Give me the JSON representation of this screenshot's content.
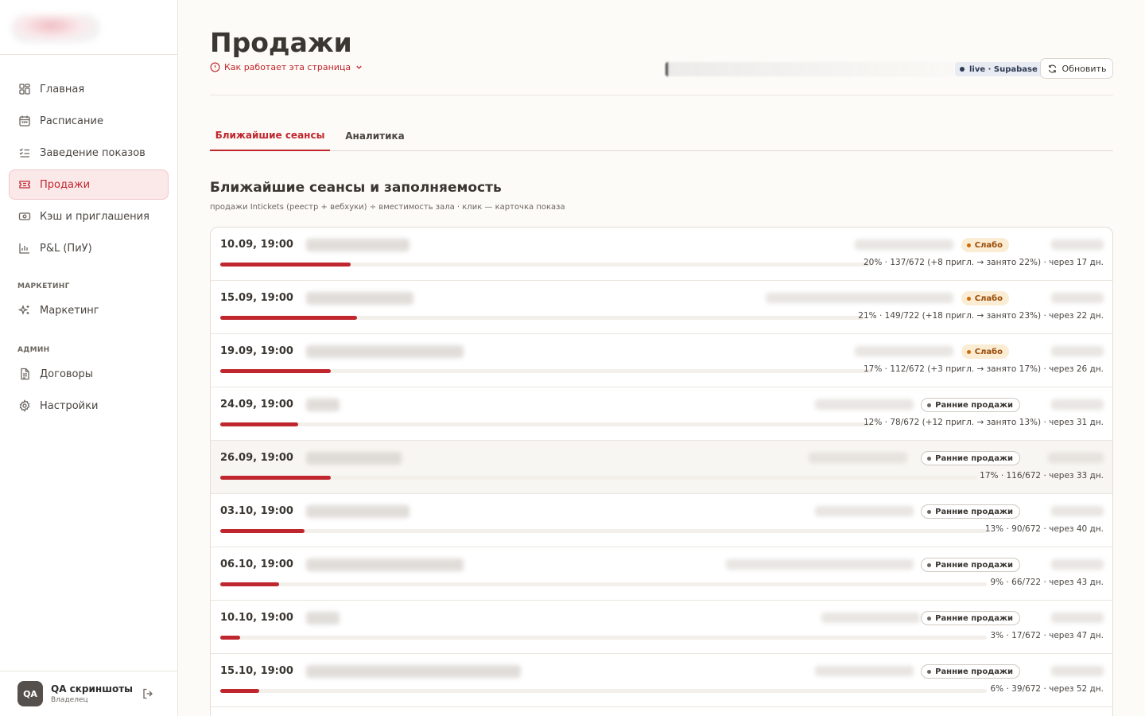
{
  "sidebar": {
    "items": [
      {
        "label": "Главная",
        "icon": "dashboard-icon"
      },
      {
        "label": "Расписание",
        "icon": "calendar-icon"
      },
      {
        "label": "Заведение показов",
        "icon": "list-check-icon"
      },
      {
        "label": "Продажи",
        "icon": "ticket-icon",
        "active": true
      },
      {
        "label": "Кэш и приглашения",
        "icon": "cash-icon"
      },
      {
        "label": "P&L (ПиУ)",
        "icon": "chart-bar-icon"
      }
    ],
    "marketing_section": "МАРКЕТИНГ",
    "marketing_items": [
      {
        "label": "Маркетинг",
        "icon": "sparkles-icon"
      }
    ],
    "admin_section": "АДМИН",
    "admin_items": [
      {
        "label": "Договоры",
        "icon": "document-icon"
      },
      {
        "label": "Настройки",
        "icon": "gear-icon"
      }
    ],
    "user": {
      "initials": "QA",
      "name": "QA скриншоты",
      "role": "Владелец"
    }
  },
  "header": {
    "title": "Продажи",
    "how_link": "Как работает эта страница",
    "live_badge": "live · Supabase",
    "refresh_label": "Обновить"
  },
  "tabs": [
    {
      "label": "Ближайшие сеансы",
      "active": true
    },
    {
      "label": "Аналитика",
      "active": false
    }
  ],
  "section": {
    "title": "Ближайшие сеансы и заполняемость",
    "subtitle": "продажи Intickets (реестр + вебхуки) ÷ вместимость зала · клик — карточка показа"
  },
  "colors": {
    "accent": "#c0262d",
    "weak_badge": "#fbecd4",
    "weak_text": "#9a4b06"
  },
  "sessions": [
    {
      "date": "10.09, 19:00",
      "badge": "Слабо",
      "badge_type": "weak",
      "fill": 0.2,
      "stats": "20% · 137/672 (+8 пригл. → занято 22%) · через 17 дн."
    },
    {
      "date": "15.09, 19:00",
      "badge": "Слабо",
      "badge_type": "weak",
      "fill": 0.21,
      "stats": "21% · 149/722 (+18 пригл. → занято 23%) · через 22 дн."
    },
    {
      "date": "19.09, 19:00",
      "badge": "Слабо",
      "badge_type": "weak",
      "fill": 0.17,
      "stats": "17% · 112/672 (+3 пригл. → занято 17%) · через 26 дн."
    },
    {
      "date": "24.09, 19:00",
      "badge": "Ранние продажи",
      "badge_type": "early",
      "fill": 0.12,
      "stats": "12% · 78/672 (+12 пригл. → занято 13%) · через 31 дн."
    },
    {
      "date": "26.09, 19:00",
      "badge": "Ранние продажи",
      "badge_type": "early",
      "fill": 0.17,
      "stats": "17% · 116/672 · через 33 дн."
    },
    {
      "date": "03.10, 19:00",
      "badge": "Ранние продажи",
      "badge_type": "early",
      "fill": 0.13,
      "stats": "13% · 90/672 · через 40 дн."
    },
    {
      "date": "06.10, 19:00",
      "badge": "Ранние продажи",
      "badge_type": "early",
      "fill": 0.09,
      "stats": "9% · 66/722 · через 43 дн."
    },
    {
      "date": "10.10, 19:00",
      "badge": "Ранние продажи",
      "badge_type": "early",
      "fill": 0.03,
      "stats": "3% · 17/672 · через 47 дн."
    },
    {
      "date": "15.10, 19:00",
      "badge": "Ранние продажи",
      "badge_type": "early",
      "fill": 0.06,
      "stats": "6% · 39/672 · через 52 дн."
    }
  ]
}
